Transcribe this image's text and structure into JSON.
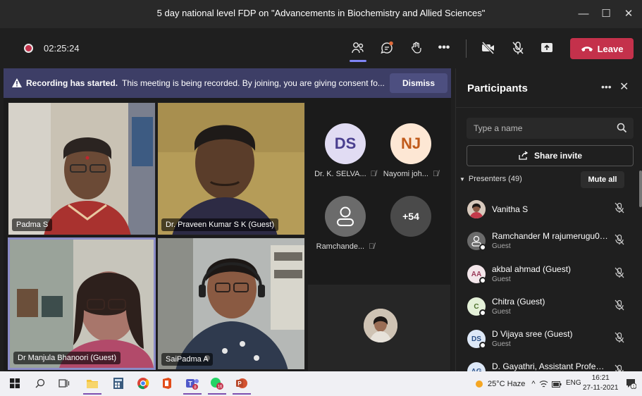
{
  "window": {
    "title": "5 day national level FDP on \"Advancements in Biochemistry and Allied Sciences\"",
    "minimize_icon": "minimize-icon",
    "maximize_icon": "maximize-icon",
    "close_icon": "close-icon"
  },
  "toolbar": {
    "timer": "02:25:24",
    "leave_label": "Leave",
    "icons": [
      "people-icon",
      "chat-icon",
      "reactions-icon",
      "more-icon",
      "camera-off-icon",
      "mic-off-icon",
      "share-icon",
      "phone-icon"
    ],
    "accent": "#7f85f5",
    "leave_color": "#c4314b"
  },
  "banner": {
    "bold": "Recording has started.",
    "message": "This meeting is being recorded. By joining, you are giving consent fo...",
    "dismiss_label": "Dismiss"
  },
  "stage": {
    "video_tiles": [
      {
        "name": "Padma S"
      },
      {
        "name": "Dr. Praveen Kumar S K (Guest)"
      },
      {
        "name": "Dr Manjula Bhanoori (Guest)"
      },
      {
        "name": "SaiPadma A"
      }
    ],
    "avatar_tiles": [
      {
        "initials": "DS",
        "label": "Dr. K. SELVA...",
        "bg": "#e1dcf3",
        "fg": "#4a3f8f"
      },
      {
        "initials": "NJ",
        "label": "Nayomi joh...",
        "bg": "#fde7d4",
        "fg": "#c05a1a"
      },
      {
        "initials": "",
        "label": "Ramchande...",
        "bg": "#6b6b6b",
        "fg": "#ffffff"
      },
      {
        "initials": "+54",
        "label": "",
        "bg": "#4a4a4a",
        "fg": "#ffffff"
      }
    ]
  },
  "panel": {
    "title": "Participants",
    "search_placeholder": "Type a name",
    "share_invite": "Share invite",
    "section": "Presenters (49)",
    "mute_all": "Mute all",
    "participants": [
      {
        "initials": "",
        "name": "Vanitha S",
        "sub": "",
        "bg": "#b98a6e"
      },
      {
        "initials": "",
        "name": "Ramchander M rajumerugu01...",
        "sub": "Guest",
        "bg": "#6b6b6b"
      },
      {
        "initials": "AA",
        "name": "akbal ahmad (Guest)",
        "sub": "Guest",
        "bg": "#f3e6ea"
      },
      {
        "initials": "C",
        "name": "Chitra (Guest)",
        "sub": "Guest",
        "bg": "#e4f0d8"
      },
      {
        "initials": "DS",
        "name": "D Vijaya sree (Guest)",
        "sub": "Guest",
        "bg": "#dde8f7"
      },
      {
        "initials": "AG",
        "name": "D. Gayathri, Assistant Profess...",
        "sub": "",
        "bg": "#dde8f7"
      }
    ]
  },
  "taskbar": {
    "weather": "25°C  Haze",
    "lang": "ENG",
    "time": "16:21",
    "date": "27-11-2021",
    "badges": {
      "teams": "8",
      "whatsapp": "16"
    }
  }
}
